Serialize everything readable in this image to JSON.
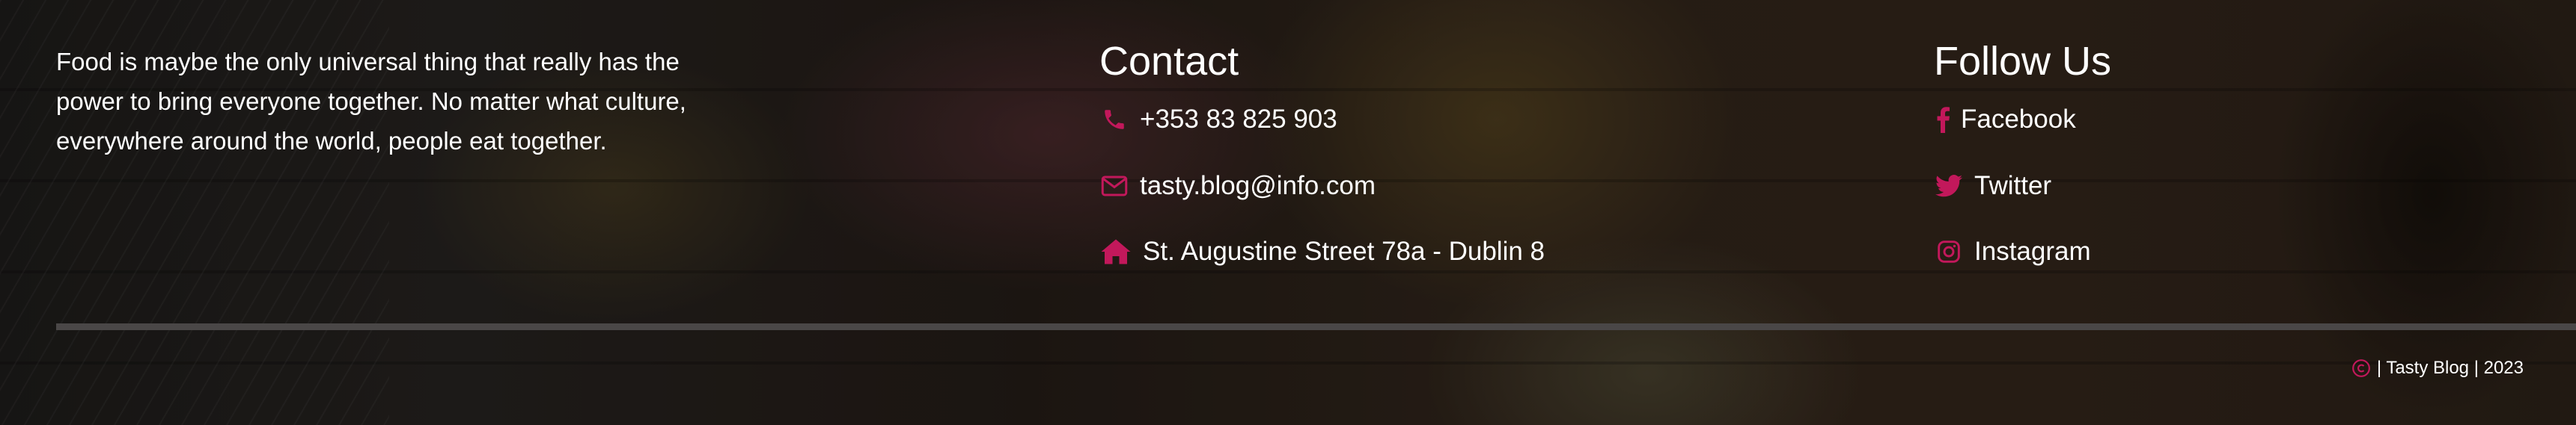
{
  "about": {
    "text": "Food is maybe the only universal thing that really has the power to bring everyone together. No matter what culture, everywhere around the world, people eat together."
  },
  "contact": {
    "title": "Contact",
    "phone": "+353 83 825 903",
    "email": "tasty.blog@info.com",
    "address": "St. Augustine Street 78a - Dublin 8"
  },
  "follow": {
    "title": "Follow Us",
    "facebook": "Facebook",
    "twitter": "Twitter",
    "instagram": "Instagram"
  },
  "footer": {
    "copyright": "| Tasty Blog | 2023"
  },
  "icons": {
    "phone": "phone-icon",
    "email": "envelope-icon",
    "address": "home-icon",
    "facebook": "facebook-icon",
    "twitter": "twitter-icon",
    "instagram": "instagram-icon",
    "copyright": "copyright-icon"
  },
  "colors": {
    "accent": "#c2185b",
    "text": "#ffffff",
    "divider": "#4a4747"
  }
}
